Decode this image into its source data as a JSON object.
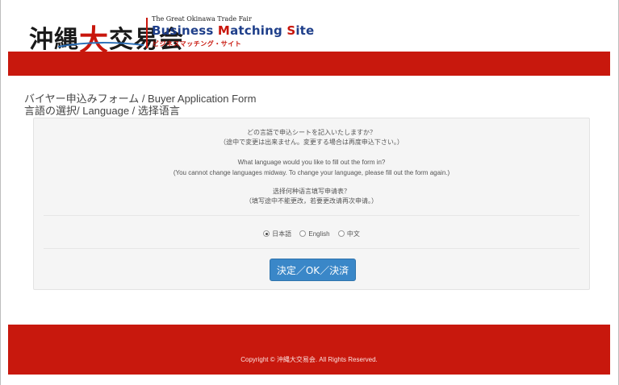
{
  "header": {
    "logo_jp_pre": "沖縄",
    "logo_jp_big": "大",
    "logo_jp_post": "交易会",
    "fair_line": "The Great Okinawa Trade Fair",
    "site_name_1": "Business ",
    "site_name_2": "M",
    "site_name_3": "atching ",
    "site_name_4": "S",
    "site_name_5": "ite",
    "site_sub": "ビジネスマッチング・サイト",
    "brand_color": "#c8160c",
    "navy_color": "#1f3f8a"
  },
  "main": {
    "title_en": "バイヤー申込みフォーム / Buyer Application Form",
    "title_lang": "言語の選択/ Language / 选择语言",
    "jp_question": "どの言語で申込シートを記入いたしますか？",
    "jp_note": "（途中で変更は出来ません。変更する場合は再度申込下さい。）",
    "en_question": "What language would you like to fill out the form in?",
    "en_note": "(You cannot change languages midway. To change your language, please fill out the form again.)",
    "zh_question": "选择何种语言填写申请表？",
    "zh_note": "（填写途中不能更改，若要更改请再次申请。）",
    "options": [
      {
        "label": "日本語",
        "checked": true
      },
      {
        "label": "English",
        "checked": false
      },
      {
        "label": "中文",
        "checked": false
      }
    ],
    "submit_label": "決定／OK／決済",
    "button_color": "#3a87c8"
  },
  "footer": {
    "copyright": "Copyright © 沖縄大交易会. All Rights Reserved.",
    "band_color": "#c8180d"
  }
}
